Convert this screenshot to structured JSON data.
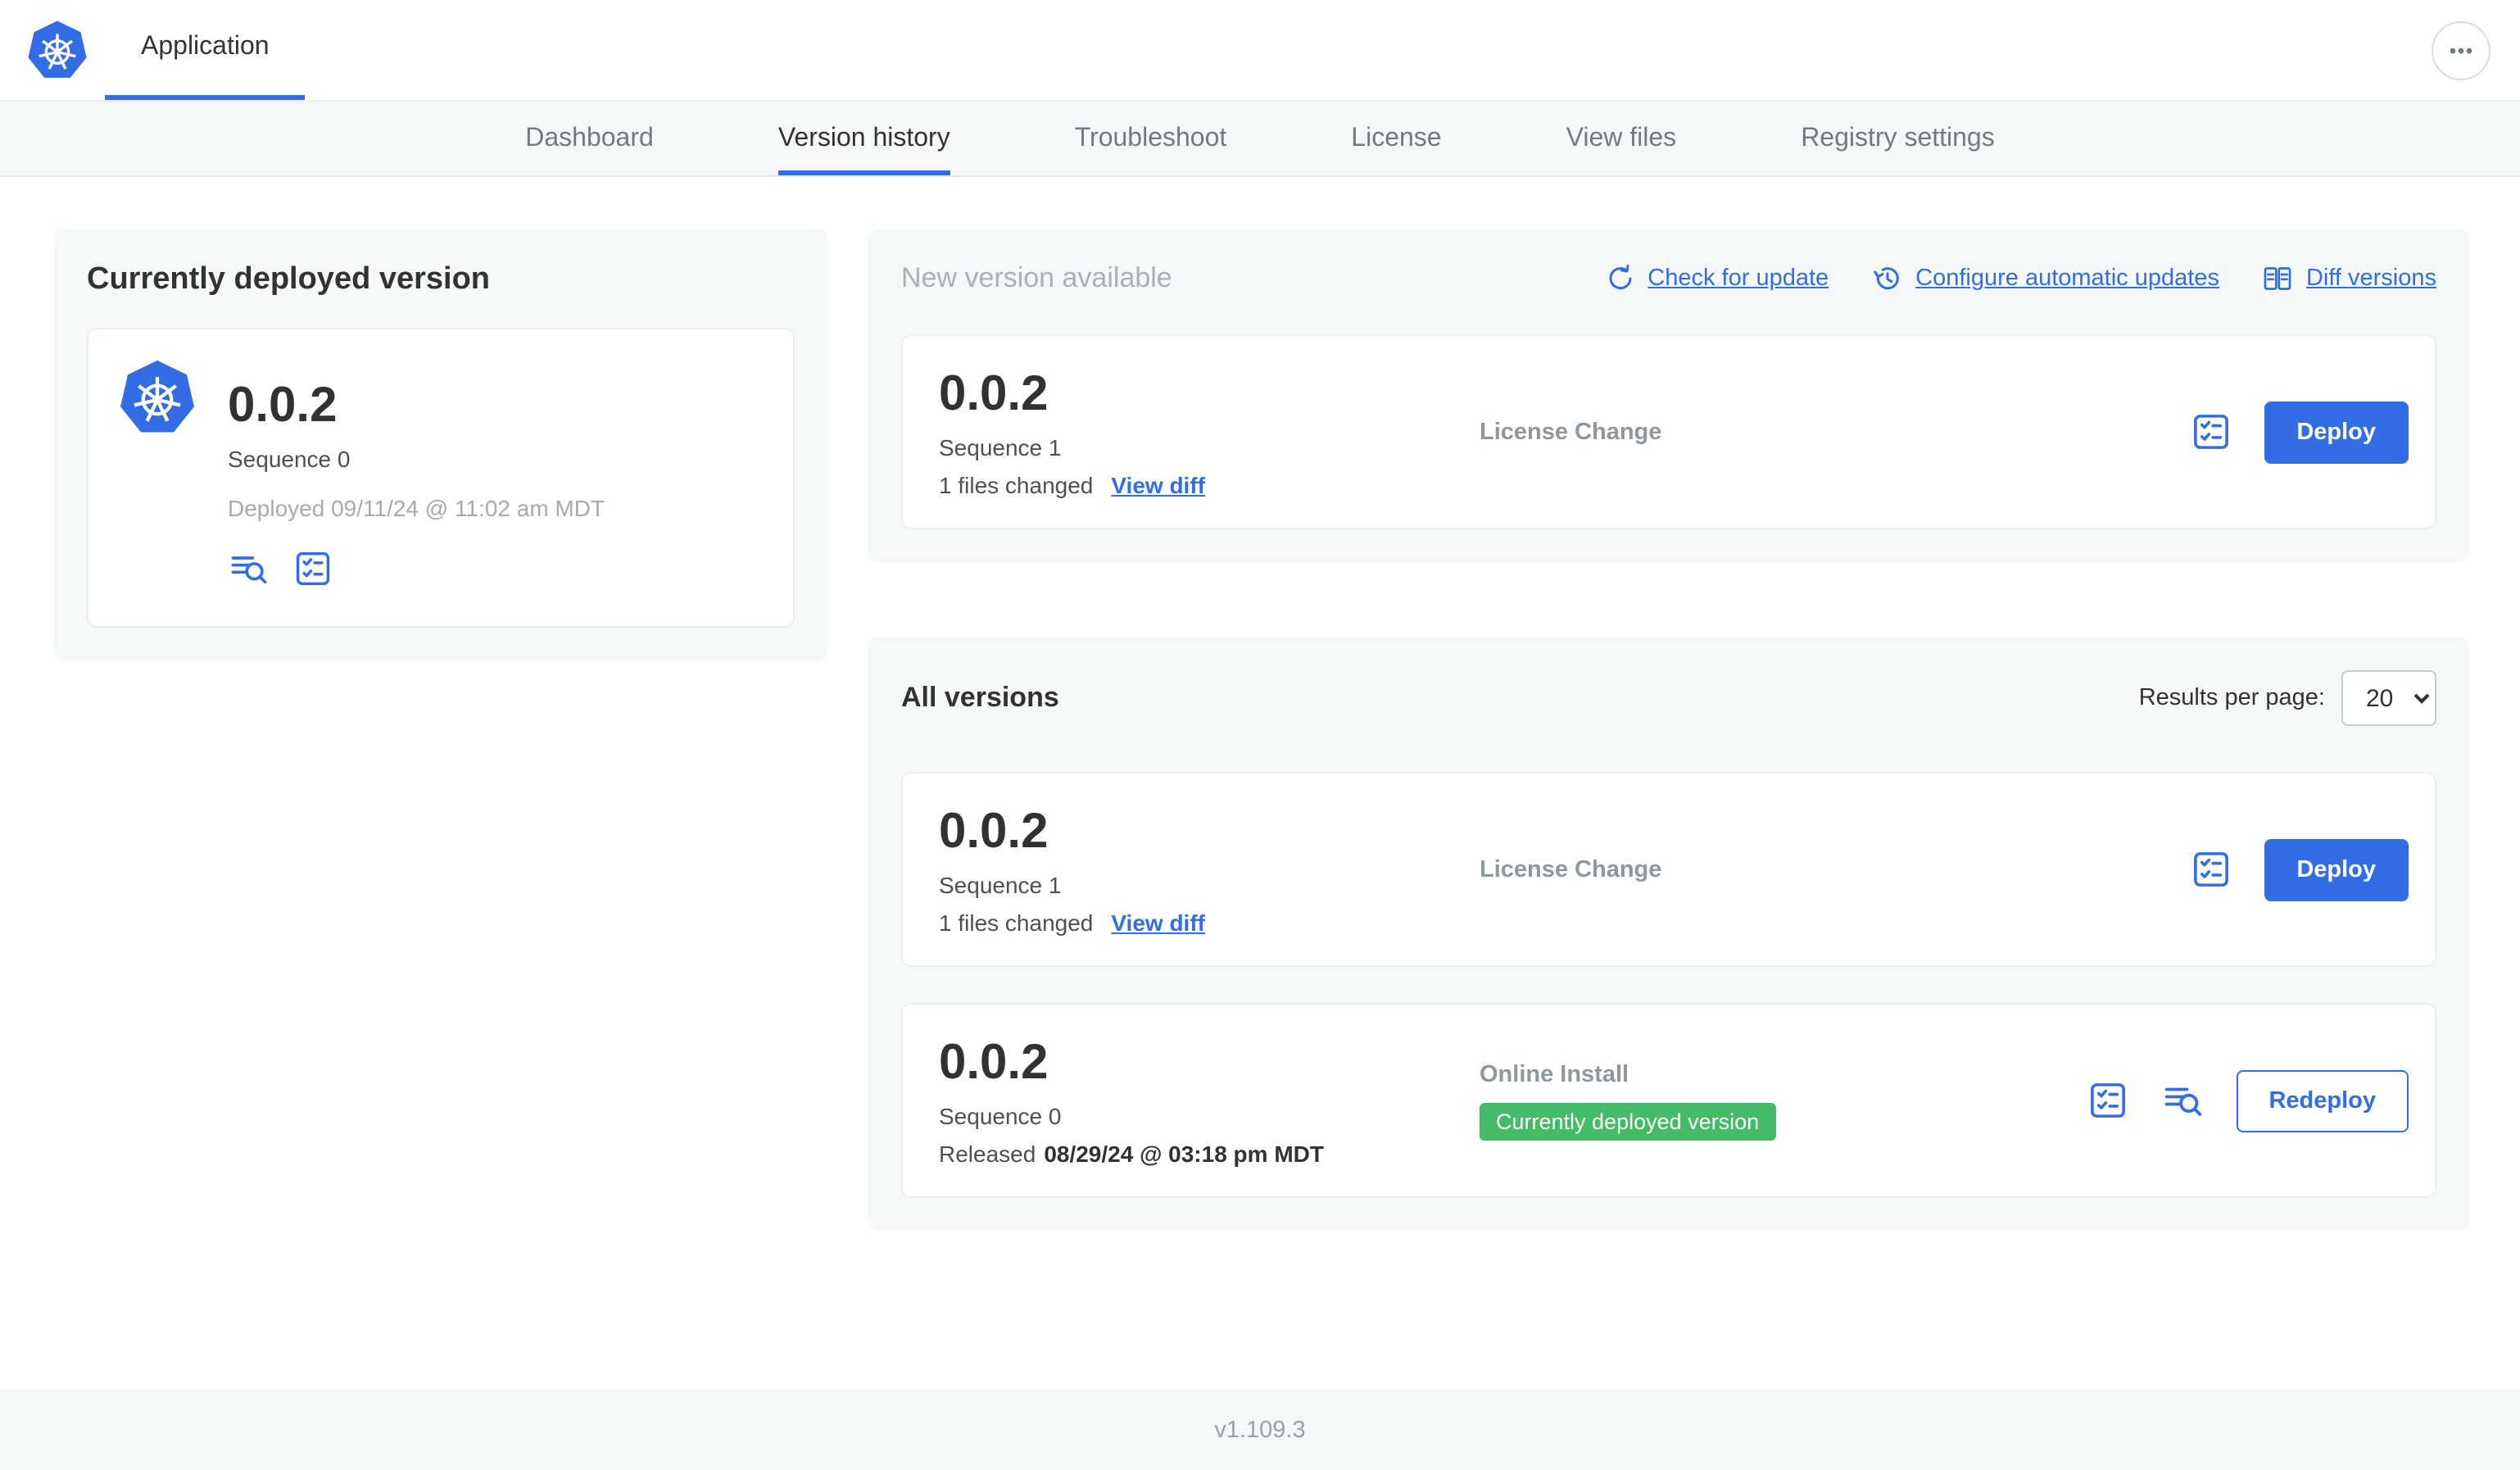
{
  "colors": {
    "accent_blue": "#326de6",
    "badge_green": "#44bb66",
    "panel_gray": "#f5f8f9",
    "text_dark": "#323232",
    "text_muted": "#a6abaf"
  },
  "icons": {
    "kubernetes-logo-icon": "blue heptagon with white helm wheel",
    "overflow-menu-icon": "ellipsis in circle",
    "check-for-update-icon": "counterclockwise refresh arrow",
    "configure-updates-icon": "clock with circular arrow",
    "diff-versions-icon": "side-by-side diff panes",
    "log-search-icon": "text lines with magnifier",
    "checklist-icon": "rounded square with checklist rows",
    "select-chevron-icon": "chevron-down"
  },
  "header": {
    "app_tab": "Application"
  },
  "nav": {
    "tabs": [
      "Dashboard",
      "Version history",
      "Troubleshoot",
      "License",
      "View files",
      "Registry settings"
    ],
    "active": "Version history"
  },
  "current": {
    "title": "Currently deployed version",
    "version": "0.0.2",
    "sequence": "Sequence 0",
    "deployed_at": "Deployed 09/11/24 @ 11:02 am MDT"
  },
  "new_version": {
    "title": "New version available",
    "links": {
      "check": "Check for update",
      "configure": "Configure automatic updates",
      "diff": "Diff versions"
    },
    "card": {
      "version": "0.0.2",
      "sequence": "Sequence 1",
      "files_changed": "1 files changed",
      "view_diff": "View diff",
      "source": "License Change",
      "action": "Deploy"
    }
  },
  "all_versions": {
    "title": "All versions",
    "results_label": "Results per page:",
    "results_value": "20",
    "rows": [
      {
        "version": "0.0.2",
        "sequence": "Sequence 1",
        "files_changed": "1 files changed",
        "view_diff": "View diff",
        "source": "License Change",
        "action": "Deploy"
      },
      {
        "version": "0.0.2",
        "sequence": "Sequence 0",
        "released_label": "Released",
        "released_date": "08/29/24 @ 03:18 pm MDT",
        "source": "Online Install",
        "badge": "Currently deployed version",
        "action": "Redeploy"
      }
    ]
  },
  "footer": {
    "version": "v1.109.3"
  }
}
